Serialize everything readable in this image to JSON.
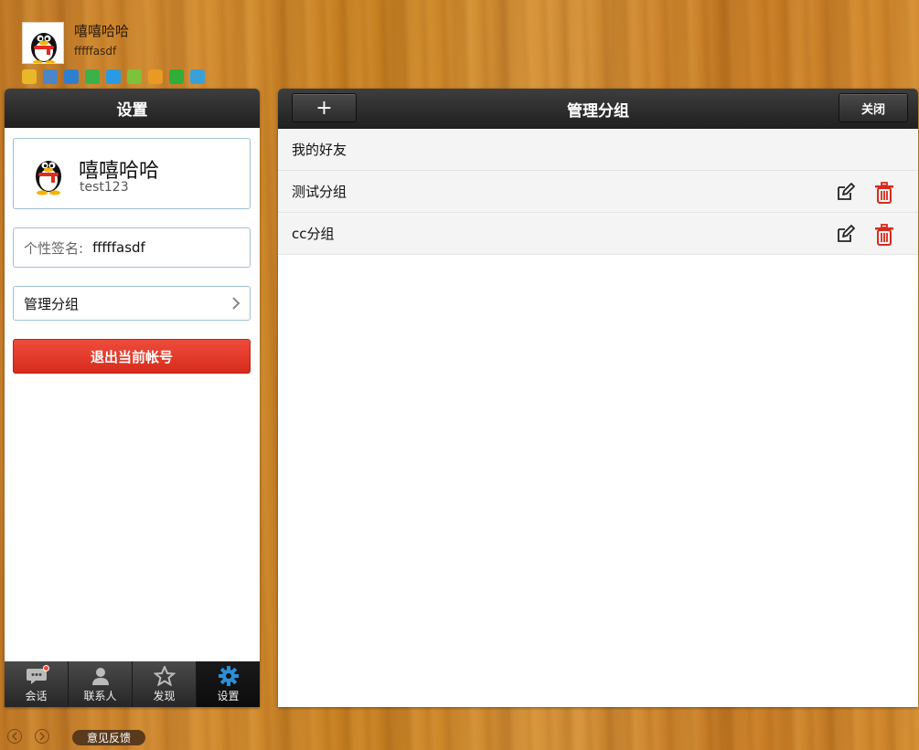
{
  "top": {
    "nickname": "嘻嘻哈哈",
    "signature": "fffffasdf",
    "app_icons": [
      {
        "name": "star-app-icon",
        "color": "#e8b82a"
      },
      {
        "name": "mail-app-icon",
        "color": "#4a86c8"
      },
      {
        "name": "search-app-icon",
        "color": "#2f7fd1"
      },
      {
        "name": "play-app-icon",
        "color": "#3ab14a"
      },
      {
        "name": "browser-app-icon",
        "color": "#2a9be0"
      },
      {
        "name": "pet-app-icon",
        "color": "#7cc23a"
      },
      {
        "name": "money-app-icon",
        "color": "#e89a22"
      },
      {
        "name": "clover-app-icon",
        "color": "#2fae3a"
      },
      {
        "name": "cloud-app-icon",
        "color": "#3aa0d8"
      }
    ]
  },
  "settings": {
    "title": "设置",
    "profile": {
      "nickname": "嘻嘻哈哈",
      "account": "test123"
    },
    "signature_label": "个性签名:",
    "signature_value": "fffffasdf",
    "manage_groups_label": "管理分组",
    "logout_label": "退出当前帐号"
  },
  "tabs": [
    {
      "label": "会话",
      "icon": "chat-icon",
      "active": false,
      "badge": true
    },
    {
      "label": "联系人",
      "icon": "contacts-icon",
      "active": false
    },
    {
      "label": "发现",
      "icon": "discover-star-icon",
      "active": false
    },
    {
      "label": "设置",
      "icon": "settings-gear-icon",
      "active": true
    }
  ],
  "manage": {
    "title": "管理分组",
    "add_label": "+",
    "close_label": "关闭",
    "groups": [
      {
        "name": "我的好友",
        "editable": false
      },
      {
        "name": "测试分组",
        "editable": true
      },
      {
        "name": "cc分组",
        "editable": true
      }
    ]
  },
  "footer": {
    "feedback_label": "意见反馈"
  },
  "colors": {
    "accent_blue": "#2b8fd8",
    "danger_red": "#d62b1d",
    "header_dark": "#2b2b2b"
  }
}
